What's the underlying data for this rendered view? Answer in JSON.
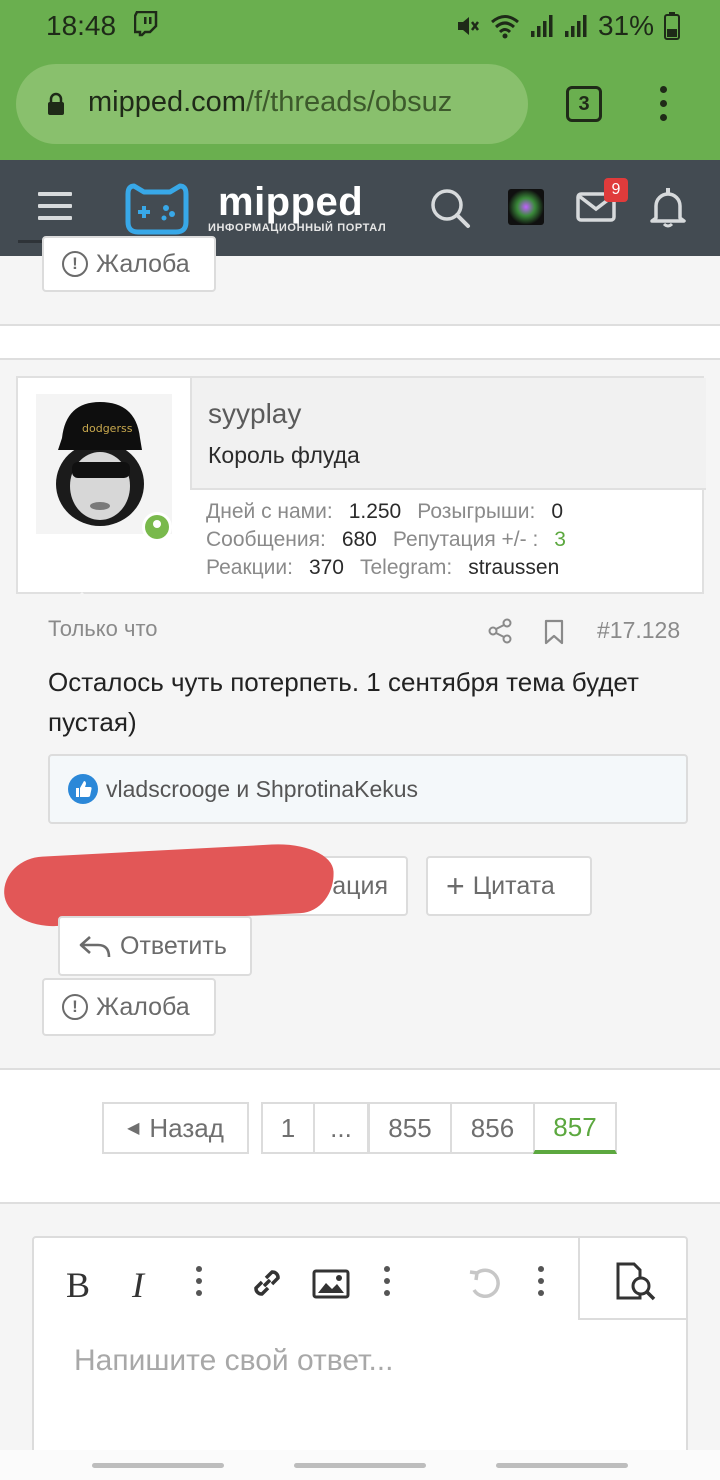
{
  "status_bar": {
    "time": "18:48",
    "battery": "31%",
    "icons": [
      "twitch-icon",
      "mute-icon",
      "wifi-icon",
      "signal-icon",
      "signal-icon",
      "battery-icon"
    ]
  },
  "browser": {
    "url_host": "mipped.com",
    "url_path": "/f/threads/obsuz",
    "tab_count": "3"
  },
  "site_header": {
    "logo_text": "mipped",
    "logo_subtitle": "ИНФОРМАЦИОННЫЙ ПОРТАЛ",
    "mail_badge": "9",
    "colors": {
      "header_bg": "#434b52",
      "accent": "#6aaf4f",
      "badge": "#e03b3b"
    }
  },
  "prev_post": {
    "report_label": "Жалоба"
  },
  "post": {
    "username": "syyplay",
    "user_title": "Король флуда",
    "stats": [
      {
        "label": "Дней с нами:",
        "value": "1.250",
        "label2": "Розыгрыши:",
        "value2": "0"
      },
      {
        "label": "Сообщения:",
        "value": "680",
        "label2": "Репутация +/- :",
        "value2": "3"
      },
      {
        "label": "Реакции:",
        "value": "370",
        "label2": "Telegram:",
        "value2": "straussen"
      }
    ],
    "time": "Только что",
    "number": "#17.128",
    "text": "Осталось чуть потерпеть. 1 сентября тема будет пустая)",
    "reactions_text": "vladscrooge и ShprotinaKekus",
    "actions": {
      "reputation_partial": "ация",
      "quote": "Цитата",
      "reply": "Ответить",
      "report": "Жалоба"
    }
  },
  "pagination": {
    "prev_label": "Назад",
    "pages": [
      "1",
      "...",
      "855",
      "856",
      "857"
    ],
    "active": "857"
  },
  "editor": {
    "placeholder": "Напишите свой ответ...",
    "toolbar": [
      "bold-icon",
      "italic-icon",
      "more-icon",
      "link-icon",
      "image-icon",
      "more-icon",
      "undo-icon",
      "more-icon",
      "preview-icon"
    ],
    "bold_glyph": "B",
    "italic_glyph": "I"
  }
}
